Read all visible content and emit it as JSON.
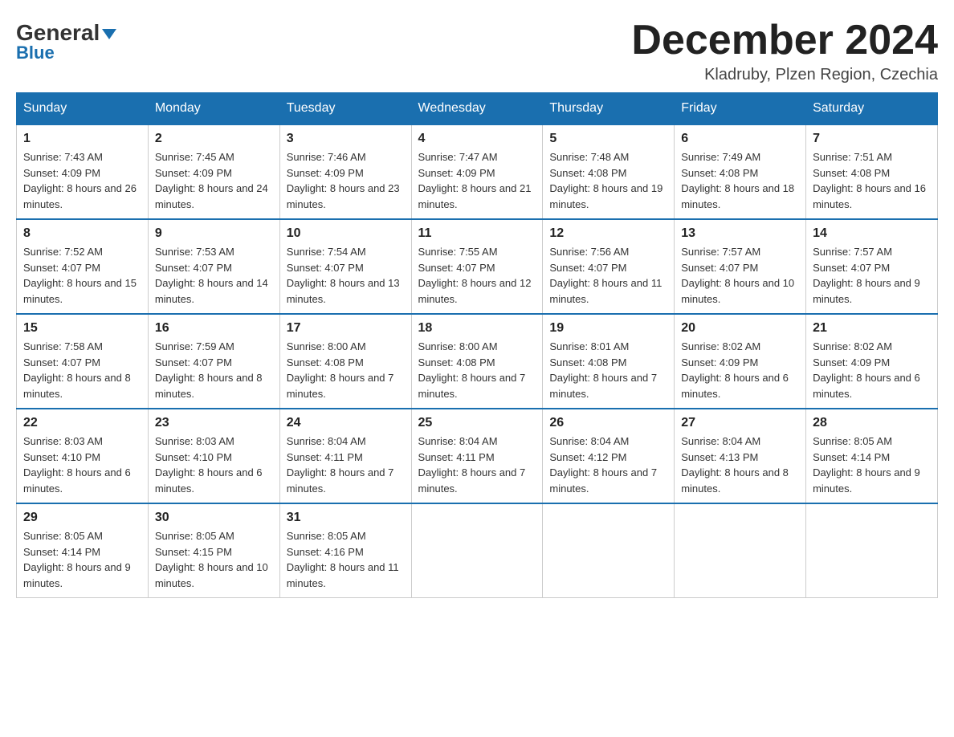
{
  "header": {
    "logo": {
      "general": "General",
      "blue": "Blue"
    },
    "title": "December 2024",
    "location": "Kladruby, Plzen Region, Czechia"
  },
  "days_of_week": [
    "Sunday",
    "Monday",
    "Tuesday",
    "Wednesday",
    "Thursday",
    "Friday",
    "Saturday"
  ],
  "weeks": [
    [
      {
        "day": "1",
        "sunrise": "7:43 AM",
        "sunset": "4:09 PM",
        "daylight": "8 hours and 26 minutes."
      },
      {
        "day": "2",
        "sunrise": "7:45 AM",
        "sunset": "4:09 PM",
        "daylight": "8 hours and 24 minutes."
      },
      {
        "day": "3",
        "sunrise": "7:46 AM",
        "sunset": "4:09 PM",
        "daylight": "8 hours and 23 minutes."
      },
      {
        "day": "4",
        "sunrise": "7:47 AM",
        "sunset": "4:09 PM",
        "daylight": "8 hours and 21 minutes."
      },
      {
        "day": "5",
        "sunrise": "7:48 AM",
        "sunset": "4:08 PM",
        "daylight": "8 hours and 19 minutes."
      },
      {
        "day": "6",
        "sunrise": "7:49 AM",
        "sunset": "4:08 PM",
        "daylight": "8 hours and 18 minutes."
      },
      {
        "day": "7",
        "sunrise": "7:51 AM",
        "sunset": "4:08 PM",
        "daylight": "8 hours and 16 minutes."
      }
    ],
    [
      {
        "day": "8",
        "sunrise": "7:52 AM",
        "sunset": "4:07 PM",
        "daylight": "8 hours and 15 minutes."
      },
      {
        "day": "9",
        "sunrise": "7:53 AM",
        "sunset": "4:07 PM",
        "daylight": "8 hours and 14 minutes."
      },
      {
        "day": "10",
        "sunrise": "7:54 AM",
        "sunset": "4:07 PM",
        "daylight": "8 hours and 13 minutes."
      },
      {
        "day": "11",
        "sunrise": "7:55 AM",
        "sunset": "4:07 PM",
        "daylight": "8 hours and 12 minutes."
      },
      {
        "day": "12",
        "sunrise": "7:56 AM",
        "sunset": "4:07 PM",
        "daylight": "8 hours and 11 minutes."
      },
      {
        "day": "13",
        "sunrise": "7:57 AM",
        "sunset": "4:07 PM",
        "daylight": "8 hours and 10 minutes."
      },
      {
        "day": "14",
        "sunrise": "7:57 AM",
        "sunset": "4:07 PM",
        "daylight": "8 hours and 9 minutes."
      }
    ],
    [
      {
        "day": "15",
        "sunrise": "7:58 AM",
        "sunset": "4:07 PM",
        "daylight": "8 hours and 8 minutes."
      },
      {
        "day": "16",
        "sunrise": "7:59 AM",
        "sunset": "4:07 PM",
        "daylight": "8 hours and 8 minutes."
      },
      {
        "day": "17",
        "sunrise": "8:00 AM",
        "sunset": "4:08 PM",
        "daylight": "8 hours and 7 minutes."
      },
      {
        "day": "18",
        "sunrise": "8:00 AM",
        "sunset": "4:08 PM",
        "daylight": "8 hours and 7 minutes."
      },
      {
        "day": "19",
        "sunrise": "8:01 AM",
        "sunset": "4:08 PM",
        "daylight": "8 hours and 7 minutes."
      },
      {
        "day": "20",
        "sunrise": "8:02 AM",
        "sunset": "4:09 PM",
        "daylight": "8 hours and 6 minutes."
      },
      {
        "day": "21",
        "sunrise": "8:02 AM",
        "sunset": "4:09 PM",
        "daylight": "8 hours and 6 minutes."
      }
    ],
    [
      {
        "day": "22",
        "sunrise": "8:03 AM",
        "sunset": "4:10 PM",
        "daylight": "8 hours and 6 minutes."
      },
      {
        "day": "23",
        "sunrise": "8:03 AM",
        "sunset": "4:10 PM",
        "daylight": "8 hours and 6 minutes."
      },
      {
        "day": "24",
        "sunrise": "8:04 AM",
        "sunset": "4:11 PM",
        "daylight": "8 hours and 7 minutes."
      },
      {
        "day": "25",
        "sunrise": "8:04 AM",
        "sunset": "4:11 PM",
        "daylight": "8 hours and 7 minutes."
      },
      {
        "day": "26",
        "sunrise": "8:04 AM",
        "sunset": "4:12 PM",
        "daylight": "8 hours and 7 minutes."
      },
      {
        "day": "27",
        "sunrise": "8:04 AM",
        "sunset": "4:13 PM",
        "daylight": "8 hours and 8 minutes."
      },
      {
        "day": "28",
        "sunrise": "8:05 AM",
        "sunset": "4:14 PM",
        "daylight": "8 hours and 9 minutes."
      }
    ],
    [
      {
        "day": "29",
        "sunrise": "8:05 AM",
        "sunset": "4:14 PM",
        "daylight": "8 hours and 9 minutes."
      },
      {
        "day": "30",
        "sunrise": "8:05 AM",
        "sunset": "4:15 PM",
        "daylight": "8 hours and 10 minutes."
      },
      {
        "day": "31",
        "sunrise": "8:05 AM",
        "sunset": "4:16 PM",
        "daylight": "8 hours and 11 minutes."
      },
      null,
      null,
      null,
      null
    ]
  ]
}
